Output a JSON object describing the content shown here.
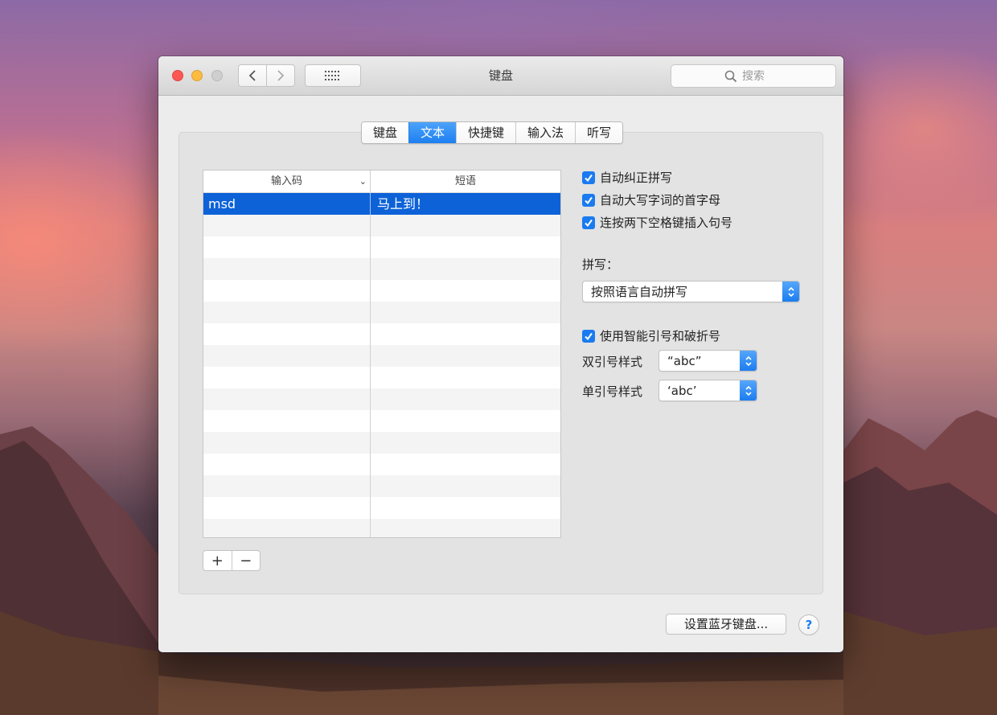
{
  "window": {
    "title": "键盘"
  },
  "toolbar": {
    "back_icon": "chevron-left-icon",
    "forward_icon": "chevron-right-icon",
    "grid_icon": "grid-icon",
    "search_placeholder": "搜索"
  },
  "tabs": [
    {
      "label": "键盘",
      "active": false
    },
    {
      "label": "文本",
      "active": true
    },
    {
      "label": "快捷键",
      "active": false
    },
    {
      "label": "输入法",
      "active": false
    },
    {
      "label": "听写",
      "active": false
    }
  ],
  "table": {
    "columns": [
      "输入码",
      "短语"
    ],
    "rows": [
      {
        "code": "msd",
        "phrase": "马上到！",
        "selected": true
      }
    ]
  },
  "buttons": {
    "add": "+",
    "remove": "−",
    "bluetooth": "设置蓝牙键盘...",
    "help": "?"
  },
  "options": {
    "auto_correct": {
      "label": "自动纠正拼写",
      "checked": true
    },
    "auto_capitalize": {
      "label": "自动大写字词的首字母",
      "checked": true
    },
    "double_space_period": {
      "label": "连按两下空格键插入句号",
      "checked": true
    },
    "smart_quotes": {
      "label": "使用智能引号和破折号",
      "checked": true
    }
  },
  "spelling": {
    "label": "拼写：",
    "value": "按照语言自动拼写"
  },
  "quotes": {
    "double_label": "双引号样式",
    "double_value": "“abc”",
    "single_label": "单引号样式",
    "single_value": "‘abc’"
  },
  "colors": {
    "accent": "#1a7bf0",
    "selection": "#0d62d8"
  }
}
